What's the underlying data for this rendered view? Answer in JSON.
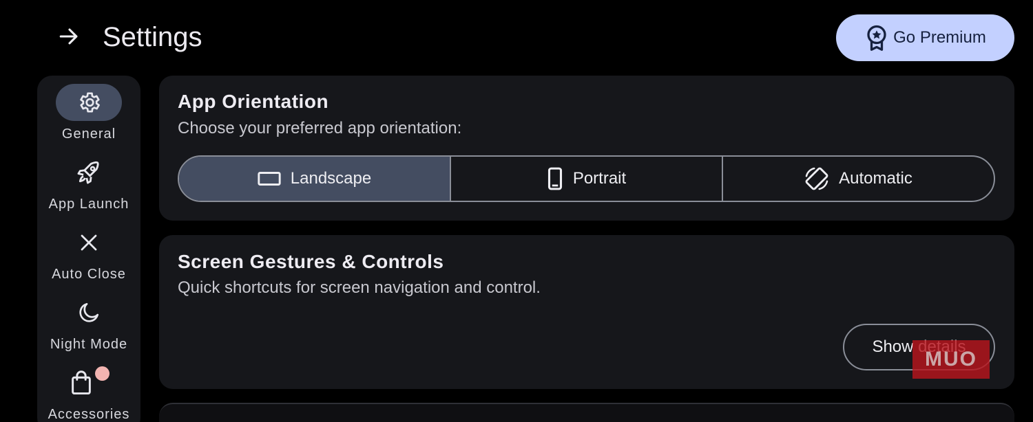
{
  "header": {
    "title": "Settings",
    "premium_label": "Go Premium"
  },
  "sidebar": {
    "items": [
      {
        "label": "General",
        "icon": "gear-icon",
        "active": true
      },
      {
        "label": "App Launch",
        "icon": "rocket-icon",
        "active": false
      },
      {
        "label": "Auto Close",
        "icon": "close-icon",
        "active": false
      },
      {
        "label": "Night Mode",
        "icon": "moon-icon",
        "active": false
      },
      {
        "label": "Accessories",
        "icon": "shopping-bag-icon",
        "active": false,
        "badge": true
      }
    ]
  },
  "orientation_card": {
    "title": "App Orientation",
    "subtitle": "Choose your preferred app orientation:",
    "options": [
      {
        "label": "Landscape",
        "icon": "landscape-icon",
        "selected": true
      },
      {
        "label": "Portrait",
        "icon": "portrait-icon",
        "selected": false
      },
      {
        "label": "Automatic",
        "icon": "screen-rotation-icon",
        "selected": false
      }
    ]
  },
  "gestures_card": {
    "title": "Screen Gestures & Controls",
    "subtitle": "Quick shortcuts for screen navigation and control.",
    "button_label": "Show details"
  },
  "watermark": "MUO",
  "colors": {
    "background": "#000000",
    "card": "#16171b",
    "accent_selected": "#444d61",
    "premium_button": "#c3d0ff",
    "badge": "#f2b4b1"
  }
}
